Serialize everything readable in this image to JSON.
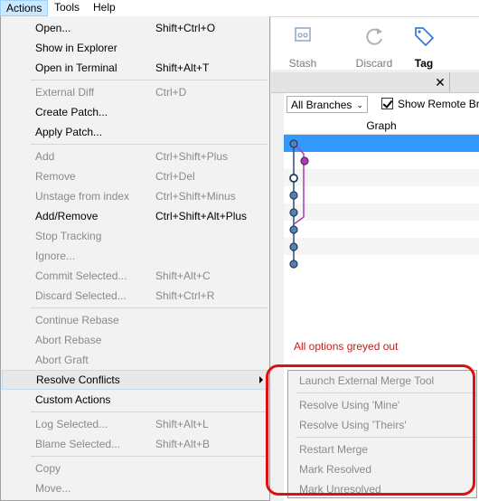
{
  "menubar": {
    "actions": "Actions",
    "tools": "Tools",
    "help": "Help"
  },
  "toolbar": {
    "stash": "Stash",
    "discard": "Discard",
    "tag": "Tag"
  },
  "tab": {
    "close": "✕"
  },
  "log": {
    "branch_filter": "All Branches",
    "show_remote_label": "Show Remote Bra",
    "show_remote_checked": true,
    "graph_header": "Graph",
    "annotation": "All options greyed out",
    "annotation_color": "#d01818"
  },
  "menu": {
    "items": [
      {
        "label": "Open...",
        "shortcut": "Shift+Ctrl+O",
        "enabled": true
      },
      {
        "label": "Show in Explorer",
        "shortcut": "",
        "enabled": true
      },
      {
        "label": "Open in Terminal",
        "shortcut": "Shift+Alt+T",
        "enabled": true
      },
      {
        "label": "External Diff",
        "shortcut": "Ctrl+D",
        "enabled": false
      },
      {
        "label": "Create Patch...",
        "shortcut": "",
        "enabled": true
      },
      {
        "label": "Apply Patch...",
        "shortcut": "",
        "enabled": true
      },
      {
        "label": "Add",
        "shortcut": "Ctrl+Shift+Plus",
        "enabled": false
      },
      {
        "label": "Remove",
        "shortcut": "Ctrl+Del",
        "enabled": false
      },
      {
        "label": "Unstage from index",
        "shortcut": "Ctrl+Shift+Minus",
        "enabled": false
      },
      {
        "label": "Add/Remove",
        "shortcut": "Ctrl+Shift+Alt+Plus",
        "enabled": true
      },
      {
        "label": "Stop Tracking",
        "shortcut": "",
        "enabled": false
      },
      {
        "label": "Ignore...",
        "shortcut": "",
        "enabled": false
      },
      {
        "label": "Commit Selected...",
        "shortcut": "Shift+Alt+C",
        "enabled": false
      },
      {
        "label": "Discard Selected...",
        "shortcut": "Shift+Ctrl+R",
        "enabled": false
      },
      {
        "label": "Continue Rebase",
        "shortcut": "",
        "enabled": false
      },
      {
        "label": "Abort Rebase",
        "shortcut": "",
        "enabled": false
      },
      {
        "label": "Abort Graft",
        "shortcut": "",
        "enabled": false
      },
      {
        "label": "Resolve Conflicts",
        "shortcut": "",
        "enabled": true
      },
      {
        "label": "Custom Actions",
        "shortcut": "",
        "enabled": true
      },
      {
        "label": "Log Selected...",
        "shortcut": "Shift+Alt+L",
        "enabled": false
      },
      {
        "label": "Blame Selected...",
        "shortcut": "Shift+Alt+B",
        "enabled": false
      },
      {
        "label": "Copy",
        "shortcut": "",
        "enabled": false
      },
      {
        "label": "Move...",
        "shortcut": "",
        "enabled": false
      }
    ]
  },
  "submenu": {
    "items": [
      {
        "label": "Launch External Merge Tool",
        "enabled": false
      },
      {
        "label": "Resolve Using 'Mine'",
        "enabled": false
      },
      {
        "label": "Resolve Using 'Theirs'",
        "enabled": false
      },
      {
        "label": "Restart Merge",
        "enabled": false
      },
      {
        "label": "Mark Resolved",
        "enabled": false
      },
      {
        "label": "Mark Unresolved",
        "enabled": false
      }
    ]
  },
  "colors": {
    "selection": "#3399ff",
    "graph_line": "#2a4f7a",
    "graph_branch": "#b03ab8",
    "disabled_text": "#8a8a8a",
    "highlight_box": "#e01010"
  }
}
